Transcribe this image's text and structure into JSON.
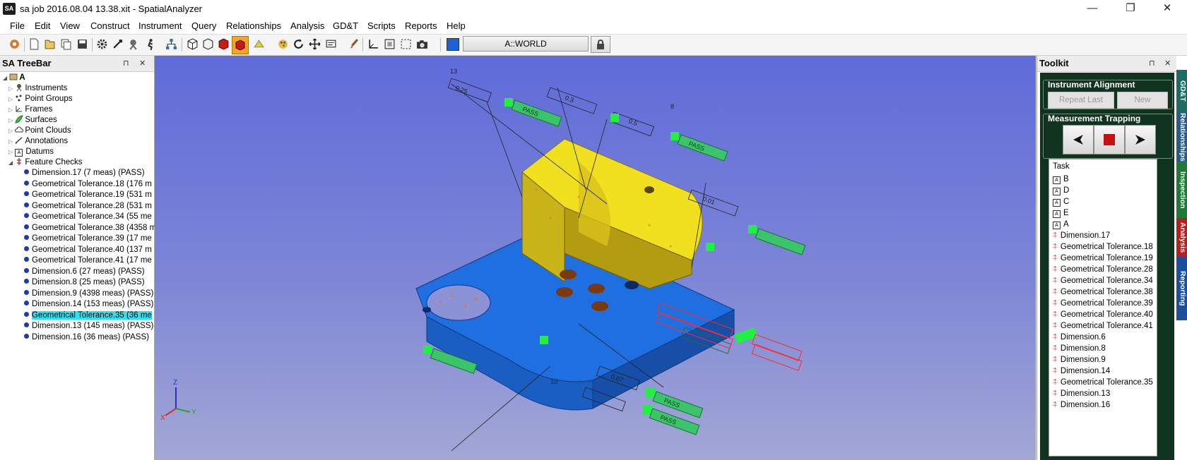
{
  "window": {
    "app_icon": "SA",
    "title": "sa job 2016.08.04 13.38.xit - SpatialAnalyzer",
    "minimize": "—",
    "maximize": "❐",
    "close": "✕"
  },
  "menu": [
    "File",
    "Edit",
    "View",
    "Construct",
    "Instrument",
    "Query",
    "Relationships",
    "Analysis",
    "GD&T",
    "Scripts",
    "Reports",
    "Help"
  ],
  "toolbar": {
    "frame_label": "A::WORLD",
    "icons": [
      "new-icon",
      "open-icon",
      "copy-icon",
      "save-icon",
      "gear-icon",
      "measure-icon",
      "instrument-icon",
      "run-icon",
      "hierarchy-icon",
      "cube-icon",
      "cube-outline-icon",
      "red-cube-icon",
      "red-cube-active-icon",
      "surface-icon",
      "palette-icon",
      "refresh-icon",
      "move-icon",
      "view-icon",
      "brush-icon",
      "axis-icon",
      "fit-icon",
      "select-icon",
      "camera-icon",
      "color-icon",
      "lock-icon"
    ]
  },
  "treebar": {
    "title": "SA TreeBar",
    "pin": "⊓",
    "close": "✕",
    "root": "A",
    "groups": [
      "Instruments",
      "Point Groups",
      "Frames",
      "Surfaces",
      "Point Clouds",
      "Annotations",
      "Datums",
      "Feature Checks"
    ],
    "checks": [
      "Dimension.17 (7 meas) (PASS)",
      "Geometrical Tolerance.18 (176 m",
      "Geometrical Tolerance.19 (531 m",
      "Geometrical Tolerance.28 (531 m",
      "Geometrical Tolerance.34 (55 me",
      "Geometrical Tolerance.38 (4358 m",
      "Geometrical Tolerance.39 (17 me",
      "Geometrical Tolerance.40 (137 m",
      "Geometrical Tolerance.41 (17 me",
      "Dimension.6 (27 meas) (PASS)",
      "Dimension.8 (25 meas) (PASS)",
      "Dimension.9 (4398 meas) (PASS)",
      "Dimension.14 (153 meas) (PASS)",
      "Geometrical Tolerance.35 (36 me",
      "Dimension.13 (145 meas) (PASS)",
      "Dimension.16 (36 meas) (PASS)"
    ],
    "selected_index": 13
  },
  "viewport": {
    "axes": {
      "z": "Z",
      "y": "Y",
      "x": "X"
    },
    "tags": [
      "PASS",
      "PASS",
      "PASS",
      "PASS"
    ],
    "tolerance_labels": [
      "0.25",
      "0.3",
      "0.5",
      "0.01",
      "0.07",
      "13",
      "8",
      "10"
    ],
    "colors": {
      "background_top": "#5f6bd9",
      "part_yellow": "#e6d21e",
      "part_blue": "#1f6fe0",
      "tag_green": "#22ee44",
      "fail_red": "#ff2a2a"
    }
  },
  "toolkit": {
    "title": "Toolkit",
    "pin": "⊓",
    "close": "✕",
    "instrument_alignment": "Instrument Alignment",
    "repeat_last": "Repeat Last",
    "new": "New",
    "measurement_trapping": "Measurement Trapping",
    "task_header": "Task",
    "datums": [
      "B",
      "D",
      "C",
      "E",
      "A"
    ],
    "tasks": [
      "Dimension.17",
      "Geometrical Tolerance.18",
      "Geometrical Tolerance.19",
      "Geometrical Tolerance.28",
      "Geometrical Tolerance.34",
      "Geometrical Tolerance.38",
      "Geometrical Tolerance.39",
      "Geometrical Tolerance.40",
      "Geometrical Tolerance.41",
      "Dimension.6",
      "Dimension.8",
      "Dimension.9",
      "Dimension.14",
      "Geometrical Tolerance.35",
      "Dimension.13",
      "Dimension.16"
    ],
    "side_tabs": [
      "GD&T",
      "Relationships",
      "Inspection",
      "Analysis",
      "Reporting"
    ]
  }
}
